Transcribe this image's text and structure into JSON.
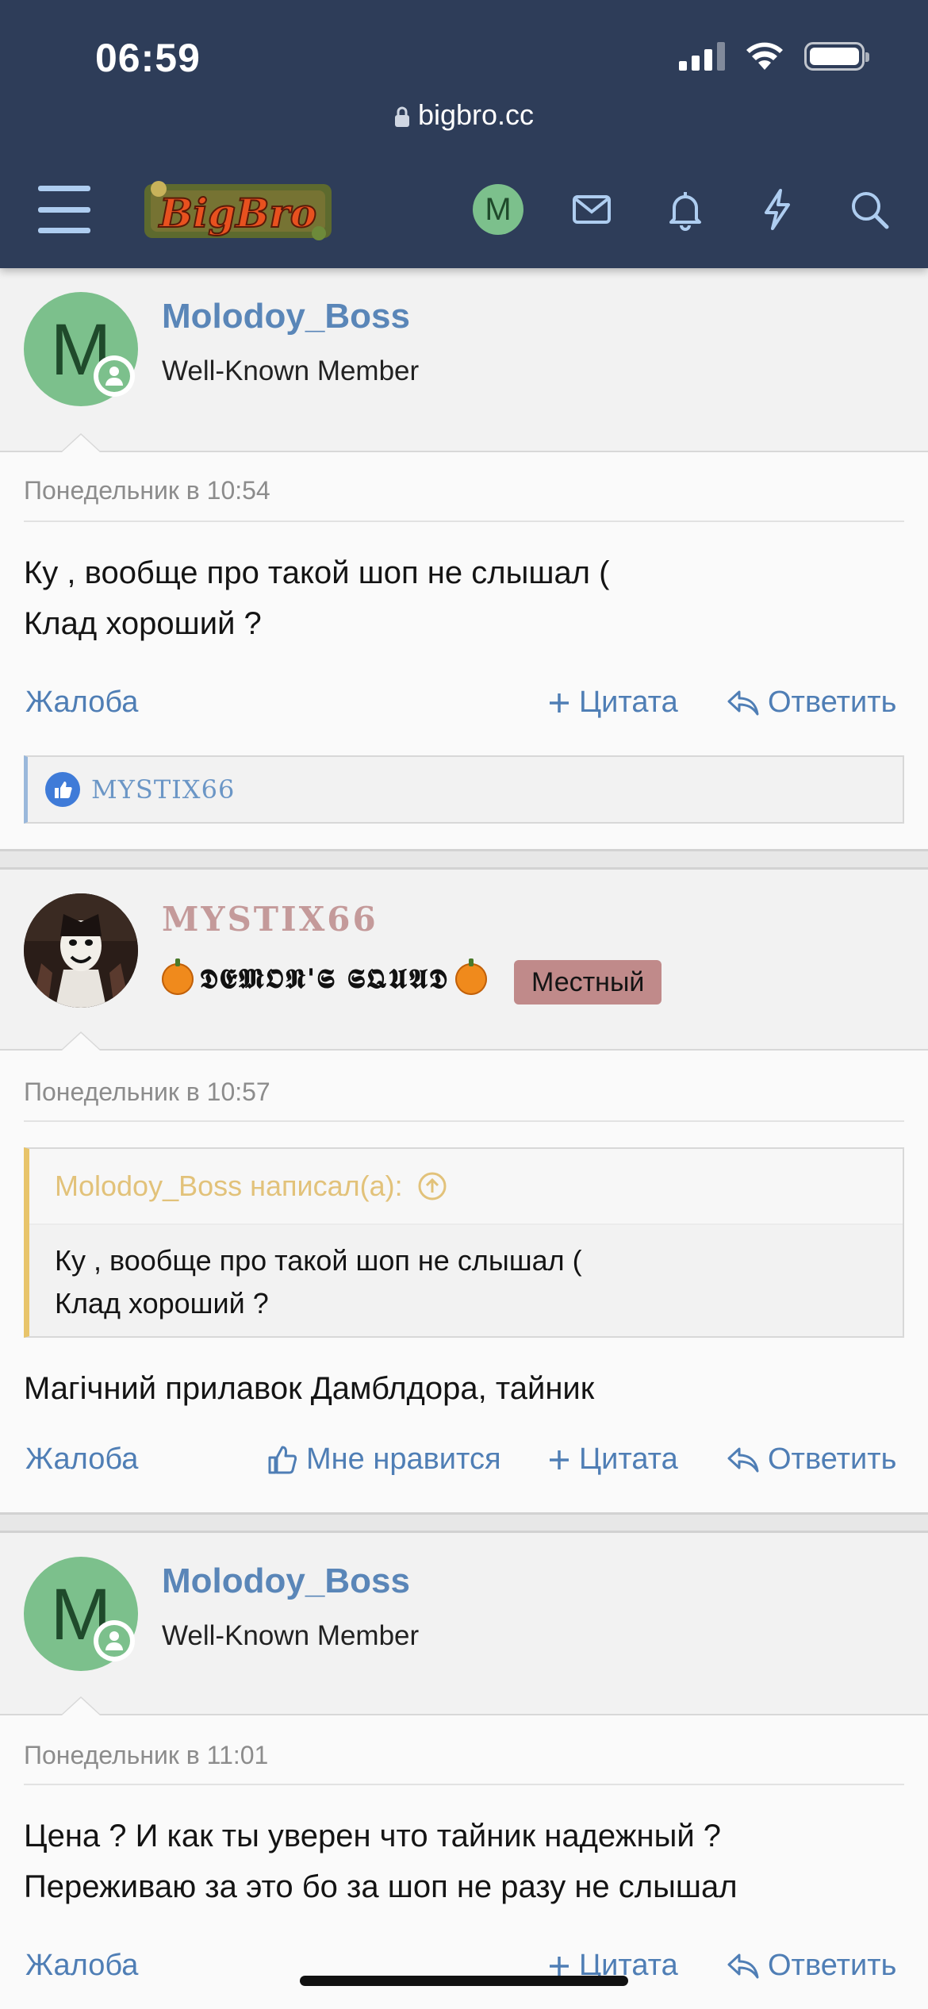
{
  "status_bar": {
    "time": "06:59"
  },
  "browser": {
    "url": "bigbro.cc"
  },
  "nav": {
    "logo_text": "BigBro",
    "avatar_letter": "M"
  },
  "posts": [
    {
      "username": "Molodoy_Boss",
      "user_title": "Well-Known Member",
      "avatar_letter": "M",
      "date": "Понедельник в 10:54",
      "message": "Ку , вообще про такой шоп не слышал (\nКлад хороший ?",
      "actions": {
        "report": "Жалоба",
        "quote": "Цитата",
        "reply": "Ответить"
      },
      "likes": "MYSTIX66"
    },
    {
      "username": "MYSTIX66",
      "user_title": "𝕯𝕰𝕸𝕺𝕹'𝕾 𝕾𝕼𝖀𝕬𝕯",
      "user_badge": "Местный",
      "date": "Понедельник в 10:57",
      "quote_author": "Molodoy_Boss написал(а):",
      "quote_text": "Ку , вообще про такой шоп не слышал (\nКлад хороший ?",
      "message": "Магічний прилавок Дамблдора, тайник",
      "actions": {
        "report": "Жалоба",
        "like": "Мне нравится",
        "quote": "Цитата",
        "reply": "Ответить"
      }
    },
    {
      "username": "Molodoy_Boss",
      "user_title": "Well-Known Member",
      "avatar_letter": "M",
      "date": "Понедельник в 11:01",
      "message": "Цена ? И как ты уверен что тайник надежный ?\nПереживаю за это бо за шоп не разу не слышал",
      "actions": {
        "report": "Жалоба",
        "quote": "Цитата",
        "reply": "Ответить"
      }
    }
  ],
  "colors": {
    "header_bg": "#2e3d59",
    "link": "#4f7eb5",
    "username": "#5a86b8",
    "avatar_bg": "#7cc08c",
    "badge_bg": "#c08a8a",
    "quote_border": "#e8c46a"
  }
}
